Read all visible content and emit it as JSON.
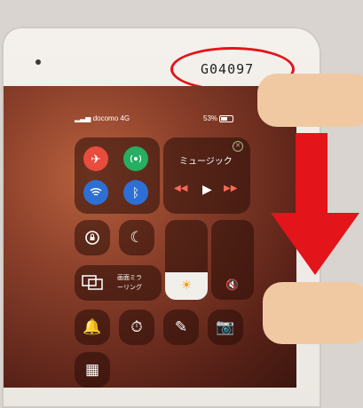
{
  "device": {
    "serial_label": "G04097"
  },
  "status_bar": {
    "carrier": "docomo 4G",
    "battery": "53%",
    "battery_level": 0.53
  },
  "control_center": {
    "connectivity": {
      "airplane": "airplane-icon",
      "cellular": "cellular-icon",
      "wifi": "wifi-icon",
      "bluetooth": "bluetooth-icon"
    },
    "music": {
      "title": "ミュージック",
      "close_glyph": "✕",
      "prev_glyph": "◀◀",
      "play_glyph": "▶",
      "next_glyph": "▶▶"
    },
    "rotation_lock": "rotation-lock-icon",
    "do_not_disturb": "moon-icon",
    "screen_mirroring": {
      "line1": "画面ミラ",
      "line2": "ーリング"
    },
    "brightness_level": 0.35,
    "volume_level": 0.0,
    "bottom_row": [
      "bell-icon",
      "timer-icon",
      "note-icon",
      "camera-icon",
      "qr-scanner-icon"
    ]
  },
  "colors": {
    "airplane": "#e74c3c",
    "cellular": "#27ae60",
    "wifi": "#2e6fd6",
    "bluetooth": "#2e6fd6",
    "annotation": "#e3141a"
  }
}
